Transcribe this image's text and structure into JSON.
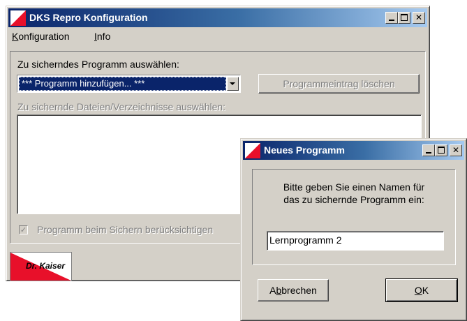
{
  "main_window": {
    "title": "DKS Repro Konfiguration",
    "menu": {
      "konfiguration": {
        "accel": "K",
        "rest": "onfiguration"
      },
      "info": {
        "accel": "I",
        "rest": "nfo"
      }
    },
    "program_label": "Zu sicherndes Programm auswählen:",
    "program_selected": "***  Programm hinzufügen...  ***",
    "delete_button": "Programmeintrag löschen",
    "files_label": "Zu sichernde Dateien/Verzeichnisse auswählen:",
    "checkbox_label": "Programm beim Sichern berücksichtigen",
    "checkbox_checked": true,
    "logo_text": "Dr. Kaiser"
  },
  "dialog": {
    "title": "Neues Programm",
    "prompt_line1": "Bitte geben Sie einen Namen für",
    "prompt_line2": "das zu sichernde Programm ein:",
    "name_value": "Lernprogramm 2",
    "cancel_button": {
      "pre": "A",
      "accel": "b",
      "post": "brechen"
    },
    "ok_button": {
      "accel": "O",
      "post": "K"
    }
  },
  "colors": {
    "titlebar_start": "#0a246a",
    "titlebar_end": "#a6caf0",
    "logo_red": "#e8102a",
    "face": "#d4d0c8"
  },
  "icons": {
    "app_icon": "red-triangle-logo-icon",
    "minimize": "minimize-icon",
    "maximize": "maximize-icon",
    "close": "close-icon"
  }
}
